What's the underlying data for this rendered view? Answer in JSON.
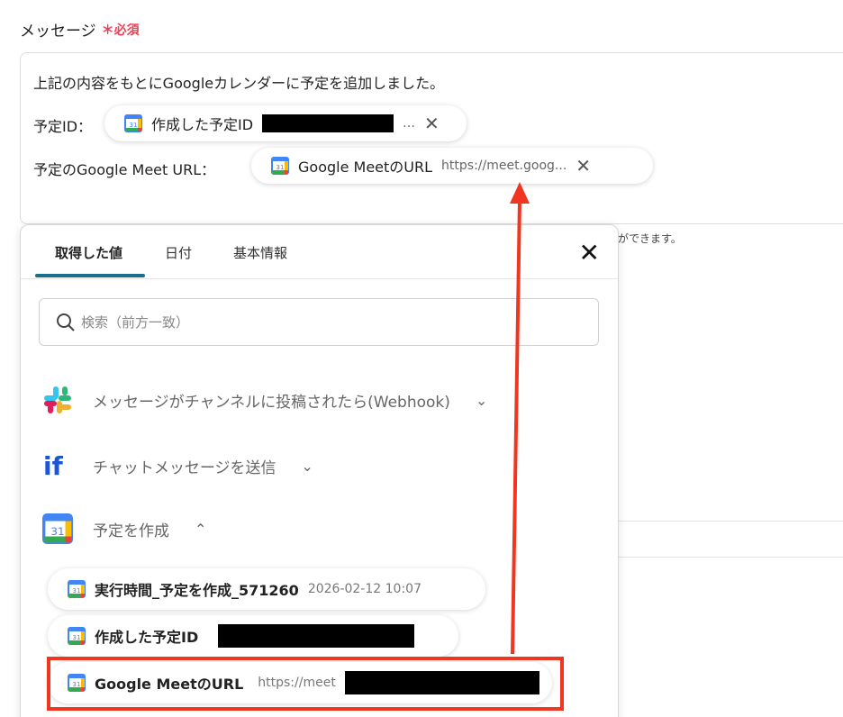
{
  "field": {
    "label": "メッセージ",
    "required": "＊必須"
  },
  "editor": {
    "line1": "上記の内容をもとにGoogleカレンダーに予定を追加しました。",
    "line2_label": "予定ID：",
    "line3_label": "予定のGoogle Meet URL：",
    "pill_event_id": {
      "title": "作成した予定ID",
      "value": "…"
    },
    "pill_meet_url": {
      "title": "Google MeetのURL",
      "value": "https://meet.goog..."
    }
  },
  "hint_text": "ができます。",
  "panel": {
    "tabs": [
      "取得した値",
      "日付",
      "基本情報"
    ],
    "active_tab": "取得した値",
    "search_placeholder": "検索（前方一致）",
    "sections": [
      {
        "title": "メッセージがチャンネルに投稿されたら(Webhook)",
        "icon": "slack-icon",
        "expanded": false
      },
      {
        "title": "チャットメッセージを送信",
        "icon": "if-icon",
        "expanded": false
      },
      {
        "title": "予定を作成",
        "icon": "google-calendar-icon",
        "expanded": true
      }
    ],
    "items": [
      {
        "title": "実行時間_予定を作成_571260",
        "value": "2026-02-12 10:07"
      },
      {
        "title": "作成した予定ID",
        "value": ""
      },
      {
        "title": "Google MeetのURL",
        "value": "https://meet"
      }
    ]
  },
  "colors": {
    "required": "#f03d52",
    "accent_tab": "#1d6d8f",
    "annotation": "#f03520"
  }
}
